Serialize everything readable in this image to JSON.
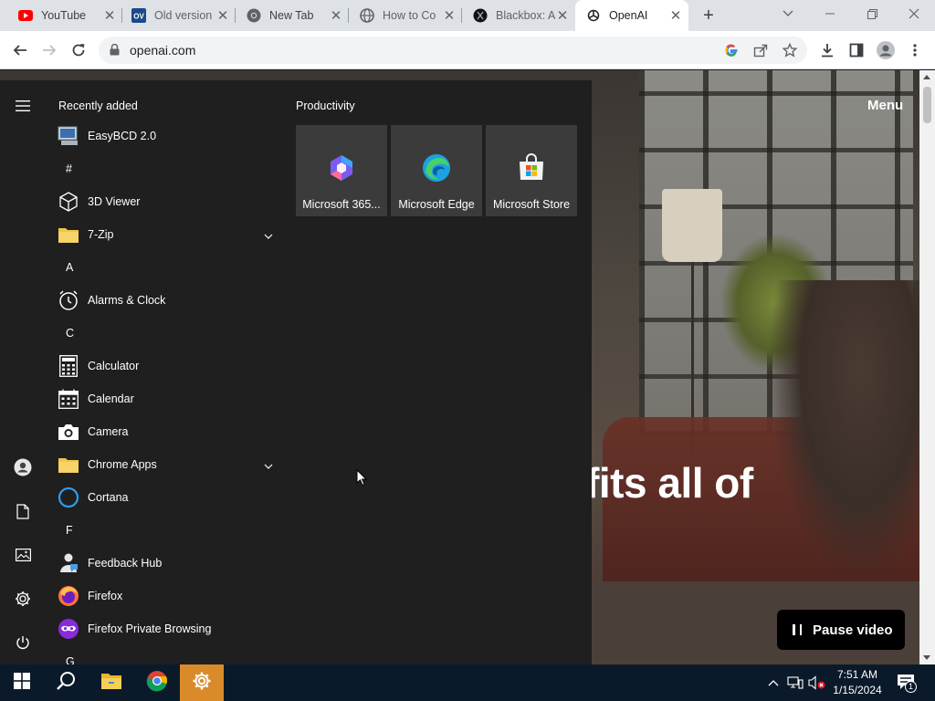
{
  "browser": {
    "tabs": [
      {
        "title": "YouTube",
        "icon": "youtube-icon",
        "active": false
      },
      {
        "title": "Old version",
        "icon": "ov-icon",
        "active": false
      },
      {
        "title": "New Tab",
        "icon": "chrome-icon",
        "active": false
      },
      {
        "title": "How to Co",
        "icon": "globe-icon",
        "active": false
      },
      {
        "title": "Blackbox: A",
        "icon": "blackbox-icon",
        "active": false
      },
      {
        "title": "OpenAI",
        "icon": "openai-icon",
        "active": true
      }
    ],
    "new_tab_label": "+",
    "url": "openai.com"
  },
  "page": {
    "menu_label": "Menu",
    "hero_text": "efits all of",
    "pause_label": "Pause video"
  },
  "start_menu": {
    "recently_added_title": "Recently added",
    "apps": [
      {
        "label": "EasyBCD 2.0",
        "icon": "easybcd-icon"
      },
      {
        "letter": "#"
      },
      {
        "label": "3D Viewer",
        "icon": "cube-icon"
      },
      {
        "label": "7-Zip",
        "icon": "folder-icon",
        "expandable": true
      },
      {
        "letter": "A"
      },
      {
        "label": "Alarms & Clock",
        "icon": "alarm-clock-icon"
      },
      {
        "letter": "C"
      },
      {
        "label": "Calculator",
        "icon": "calculator-icon"
      },
      {
        "label": "Calendar",
        "icon": "calendar-icon"
      },
      {
        "label": "Camera",
        "icon": "camera-icon"
      },
      {
        "label": "Chrome Apps",
        "icon": "folder-icon",
        "expandable": true
      },
      {
        "label": "Cortana",
        "icon": "cortana-icon"
      },
      {
        "letter": "F"
      },
      {
        "label": "Feedback Hub",
        "icon": "feedback-hub-icon"
      },
      {
        "label": "Firefox",
        "icon": "firefox-icon"
      },
      {
        "label": "Firefox Private Browsing",
        "icon": "firefox-private-icon"
      },
      {
        "letter": "G"
      }
    ],
    "tile_group_title": "Productivity",
    "tiles": [
      {
        "label": "Microsoft 365...",
        "icon": "microsoft-365-icon"
      },
      {
        "label": "Microsoft Edge",
        "icon": "edge-icon"
      },
      {
        "label": "Microsoft Store",
        "icon": "store-icon"
      }
    ]
  },
  "taskbar": {
    "clock_time": "7:51 AM",
    "clock_date": "1/15/2024",
    "notification_count": "1"
  },
  "colors": {
    "start_bg": "#1f1f1f",
    "tile_bg": "#3b3b3b",
    "taskbar_bg": "#0b1a2a",
    "settings_accent": "#d98b2a"
  }
}
